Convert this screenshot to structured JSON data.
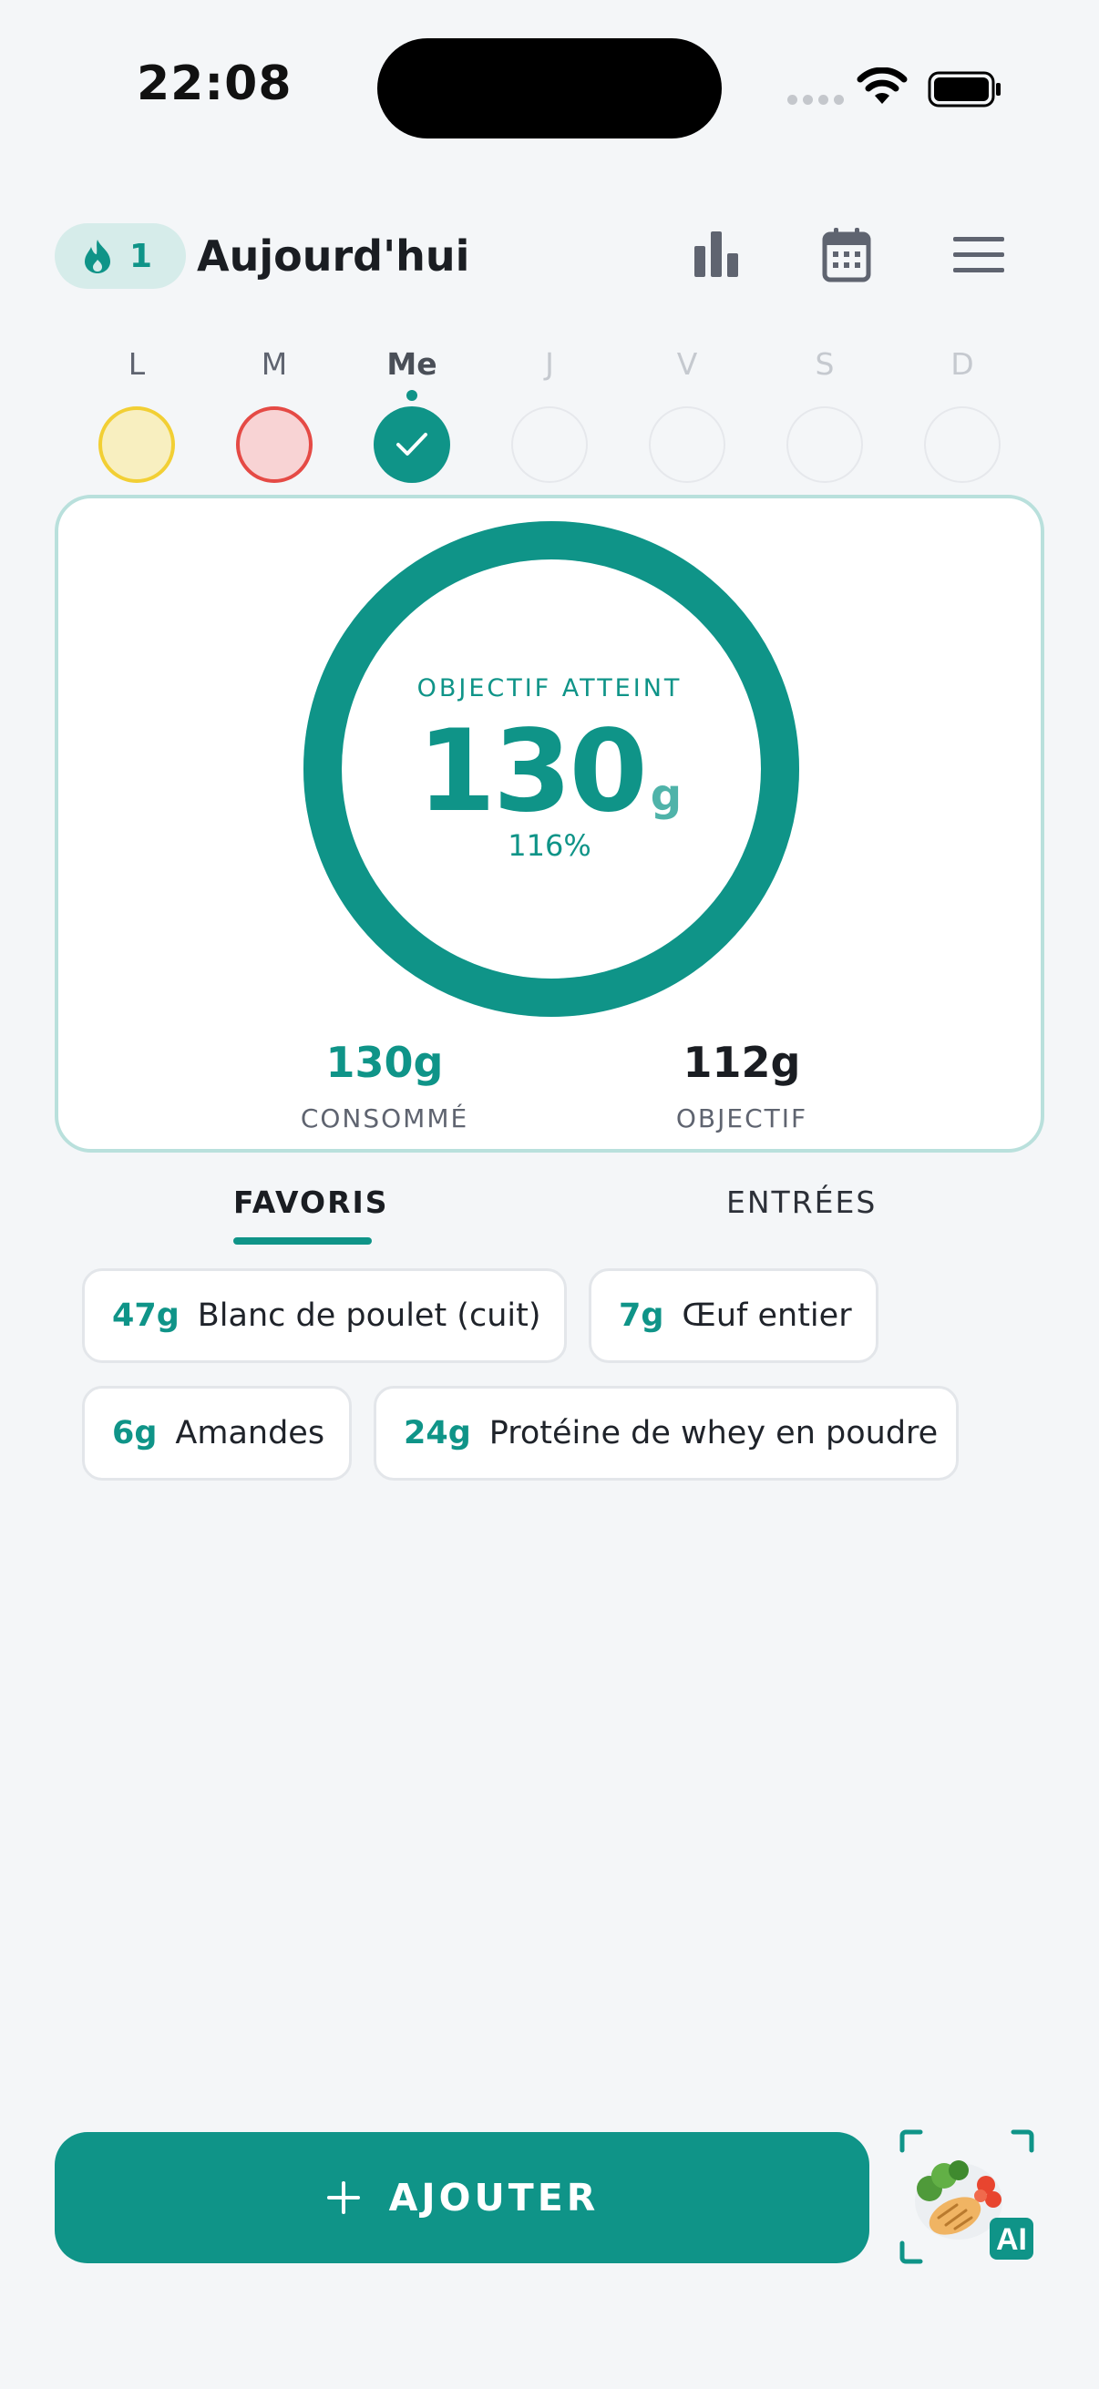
{
  "status_bar": {
    "time": "22:08"
  },
  "header": {
    "streak_count": "1",
    "title": "Aujourd'hui"
  },
  "week": {
    "days": [
      {
        "label": "L",
        "state": "partial"
      },
      {
        "label": "M",
        "state": "missed"
      },
      {
        "label": "Me",
        "state": "done"
      },
      {
        "label": "J",
        "state": "future"
      },
      {
        "label": "V",
        "state": "future"
      },
      {
        "label": "S",
        "state": "future"
      },
      {
        "label": "D",
        "state": "future"
      }
    ]
  },
  "progress": {
    "status_label": "OBJECTIF ATTEINT",
    "value": "130",
    "unit": "g",
    "percent": "116%",
    "percent_value": 116,
    "consumed_value": "130g",
    "consumed_label": "CONSOMMÉ",
    "goal_value": "112g",
    "goal_label": "OBJECTIF"
  },
  "tabs": [
    {
      "label": "FAVORIS",
      "active": true
    },
    {
      "label": "ENTRÉES",
      "active": false
    }
  ],
  "favorites": [
    {
      "grams": "47g",
      "name": "Blanc de poulet (cuit)"
    },
    {
      "grams": "7g",
      "name": "Œuf entier"
    },
    {
      "grams": "6g",
      "name": "Amandes"
    },
    {
      "grams": "24g",
      "name": "Protéine de whey en poudre"
    }
  ],
  "add_button": {
    "label": "AJOUTER"
  },
  "ai_button": {
    "badge": "AI"
  },
  "colors": {
    "accent": "#0f9488",
    "ring_border": "#b9e0dc",
    "partial": "#f8efc0",
    "missed": "#f8d3d4"
  }
}
